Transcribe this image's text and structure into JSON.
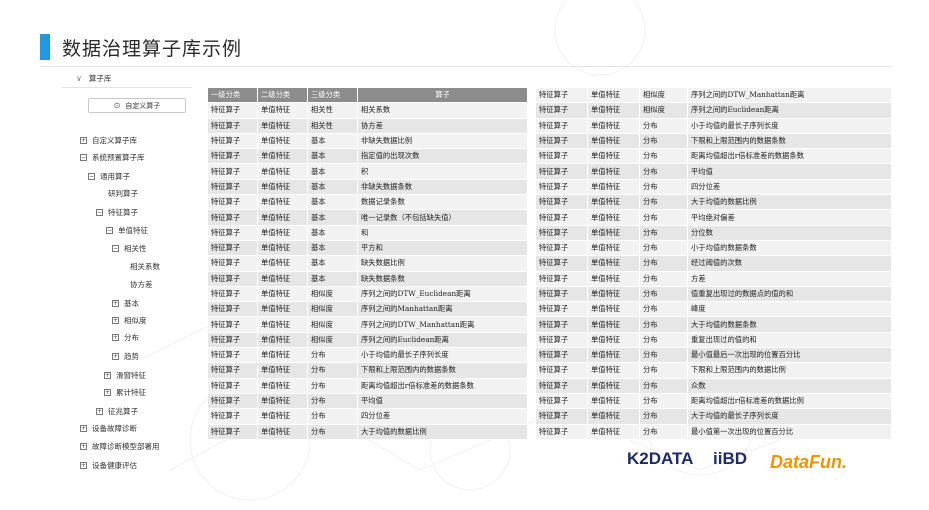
{
  "page": {
    "title": "数据治理算子库示例"
  },
  "tree": {
    "header": "算子库",
    "custom_button": "自定义算子",
    "items": [
      {
        "label": "自定义算子库",
        "toggle": "+"
      },
      {
        "label": "系统预置算子库",
        "toggle": "−"
      },
      {
        "label": "通用算子",
        "toggle": "−"
      },
      {
        "label": "研判算子",
        "toggle": ""
      },
      {
        "label": "特征算子",
        "toggle": "−"
      },
      {
        "label": "单值特征",
        "toggle": "−"
      },
      {
        "label": "相关性",
        "toggle": "−"
      },
      {
        "label": "相关系数",
        "toggle": ""
      },
      {
        "label": "协方差",
        "toggle": ""
      },
      {
        "label": "基本",
        "toggle": "+"
      },
      {
        "label": "相似度",
        "toggle": "+"
      },
      {
        "label": "分布",
        "toggle": "+"
      },
      {
        "label": "趋势",
        "toggle": "+"
      },
      {
        "label": "滑窗特征",
        "toggle": "+"
      },
      {
        "label": "累计特征",
        "toggle": "+"
      },
      {
        "label": "征兆算子",
        "toggle": "+"
      },
      {
        "label": "设备故障诊断",
        "toggle": "+"
      },
      {
        "label": "故障诊断模型部署用",
        "toggle": "+"
      },
      {
        "label": "设备健康评估",
        "toggle": "+"
      }
    ]
  },
  "left_table": {
    "headers": [
      "一级分类",
      "二级分类",
      "三级分类",
      "算子"
    ],
    "rows": [
      [
        "特征算子",
        "单值特征",
        "相关性",
        "相关系数"
      ],
      [
        "特征算子",
        "单值特征",
        "相关性",
        "协方差"
      ],
      [
        "特征算子",
        "单值特征",
        "基本",
        "非缺失数据比例"
      ],
      [
        "特征算子",
        "单值特征",
        "基本",
        "指定值的出现次数"
      ],
      [
        "特征算子",
        "单值特征",
        "基本",
        "积"
      ],
      [
        "特征算子",
        "单值特征",
        "基本",
        "非缺失数据条数"
      ],
      [
        "特征算子",
        "单值特征",
        "基本",
        "数据记录条数"
      ],
      [
        "特征算子",
        "单值特征",
        "基本",
        "唯一记录数（不包括缺失值）"
      ],
      [
        "特征算子",
        "单值特征",
        "基本",
        "和"
      ],
      [
        "特征算子",
        "单值特征",
        "基本",
        "平方和"
      ],
      [
        "特征算子",
        "单值特征",
        "基本",
        "缺失数据比例"
      ],
      [
        "特征算子",
        "单值特征",
        "基本",
        "缺失数据条数"
      ],
      [
        "特征算子",
        "单值特征",
        "相似度",
        "序列之间的DTW_Euclidean距离"
      ],
      [
        "特征算子",
        "单值特征",
        "相似度",
        "序列之间的Manhattan距离"
      ],
      [
        "特征算子",
        "单值特征",
        "相似度",
        "序列之间的DTW_Manhattan距离"
      ],
      [
        "特征算子",
        "单值特征",
        "相似度",
        "序列之间的Euclidean距离"
      ],
      [
        "特征算子",
        "单值特征",
        "分布",
        "小于均值的最长子序列长度"
      ],
      [
        "特征算子",
        "单值特征",
        "分布",
        "下限和上限范围内的数据条数"
      ],
      [
        "特征算子",
        "单值特征",
        "分布",
        "距离均值超出r倍标准差的数据条数"
      ],
      [
        "特征算子",
        "单值特征",
        "分布",
        "平均值"
      ],
      [
        "特征算子",
        "单值特征",
        "分布",
        "四分位差"
      ],
      [
        "特征算子",
        "单值特征",
        "分布",
        "大于均值的数据比例"
      ]
    ]
  },
  "right_table": {
    "rows": [
      [
        "特征算子",
        "单值特征",
        "相似度",
        "序列之间的DTW_Manhattan距离"
      ],
      [
        "特征算子",
        "单值特征",
        "相似度",
        "序列之间的Euclidean距离"
      ],
      [
        "特征算子",
        "单值特征",
        "分布",
        "小于均值的最长子序列长度"
      ],
      [
        "特征算子",
        "单值特征",
        "分布",
        "下限和上限范围内的数据条数"
      ],
      [
        "特征算子",
        "单值特征",
        "分布",
        "距离均值超出r倍标准差的数据条数"
      ],
      [
        "特征算子",
        "单值特征",
        "分布",
        "平均值"
      ],
      [
        "特征算子",
        "单值特征",
        "分布",
        "四分位差"
      ],
      [
        "特征算子",
        "单值特征",
        "分布",
        "大于均值的数据比例"
      ],
      [
        "特征算子",
        "单值特征",
        "分布",
        "平均绝对偏差"
      ],
      [
        "特征算子",
        "单值特征",
        "分布",
        "分位数"
      ],
      [
        "特征算子",
        "单值特征",
        "分布",
        "小于均值的数据条数"
      ],
      [
        "特征算子",
        "单值特征",
        "分布",
        "经过阈值的次数"
      ],
      [
        "特征算子",
        "单值特征",
        "分布",
        "方差"
      ],
      [
        "特征算子",
        "单值特征",
        "分布",
        "值重复出现过的数据点的值的和"
      ],
      [
        "特征算子",
        "单值特征",
        "分布",
        "峰度"
      ],
      [
        "特征算子",
        "单值特征",
        "分布",
        "大于均值的数据条数"
      ],
      [
        "特征算子",
        "单值特征",
        "分布",
        "重复出现过的值的和"
      ],
      [
        "特征算子",
        "单值特征",
        "分布",
        "最小值最后一次出现的位置百分比"
      ],
      [
        "特征算子",
        "单值特征",
        "分布",
        "下限和上限范围内的数据比例"
      ],
      [
        "特征算子",
        "单值特征",
        "分布",
        "众数"
      ],
      [
        "特征算子",
        "单值特征",
        "分布",
        "距离均值超出r倍标准差的数据比例"
      ],
      [
        "特征算子",
        "单值特征",
        "分布",
        "大于均值的最长子序列长度"
      ],
      [
        "特征算子",
        "单值特征",
        "分布",
        "最小值第一次出现的位置百分比"
      ]
    ]
  },
  "logos": {
    "k2data": "K2DATA",
    "iibd": "iiBD",
    "datafun": "DataFun."
  },
  "icons": {
    "chevron": "chevron-down-icon",
    "gear": "gear-icon"
  },
  "colors": {
    "accent": "#1f9ae0",
    "header_bg": "#8c8c8c",
    "row_light": "#f2f2f2",
    "row_dark": "#e6e6e6"
  }
}
